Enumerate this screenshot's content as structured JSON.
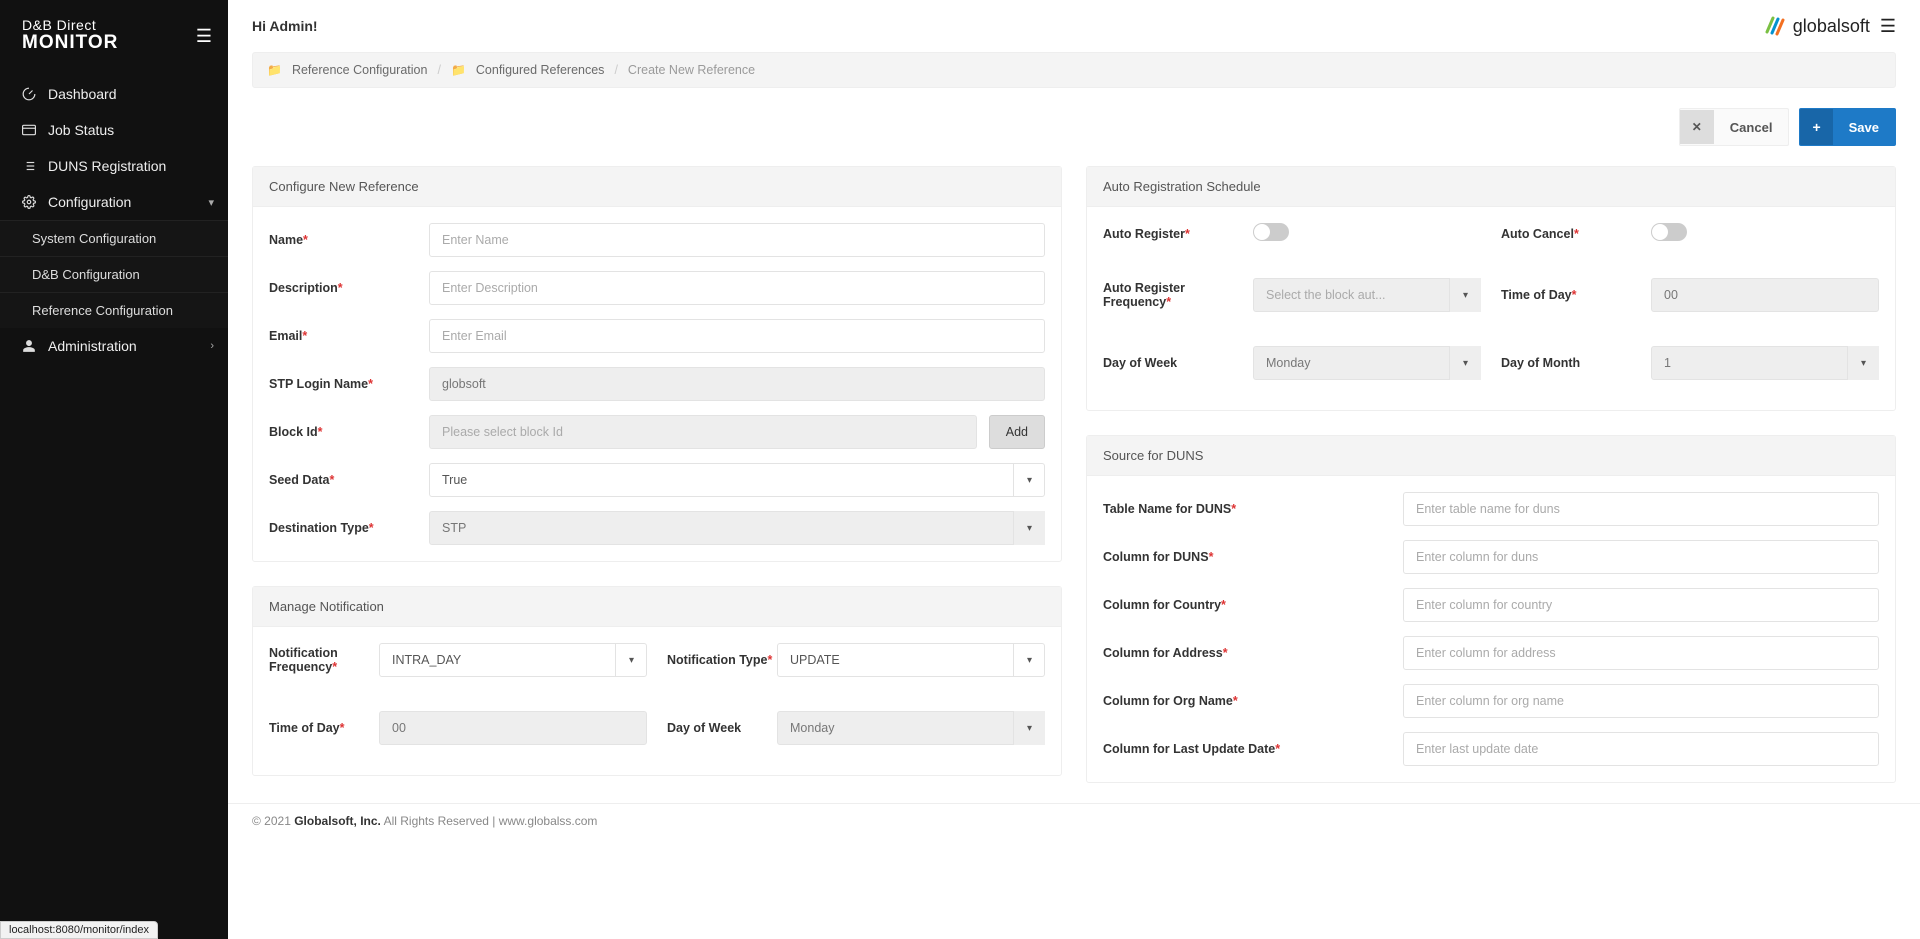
{
  "logo": {
    "line1": "D&B Direct",
    "line2": "MONITOR"
  },
  "sidebar": {
    "items": [
      {
        "icon": "gauge",
        "label": "Dashboard"
      },
      {
        "icon": "card",
        "label": "Job Status"
      },
      {
        "icon": "list",
        "label": "DUNS Registration"
      },
      {
        "icon": "gear",
        "label": "Configuration",
        "expanded": true,
        "children": [
          {
            "label": "System Configuration"
          },
          {
            "label": "D&B Configuration"
          },
          {
            "label": "Reference Configuration"
          }
        ]
      },
      {
        "icon": "user",
        "label": "Administration",
        "expanded": false
      }
    ]
  },
  "header": {
    "greeting": "Hi Admin!",
    "brand": "globalsoft"
  },
  "breadcrumbs": {
    "item1": "Reference Configuration",
    "item2": "Configured References",
    "current": "Create New Reference"
  },
  "actions": {
    "cancel": "Cancel",
    "save": "Save"
  },
  "configure": {
    "title": "Configure New Reference",
    "name_label": "Name",
    "name_ph": "Enter Name",
    "desc_label": "Description",
    "desc_ph": "Enter Description",
    "email_label": "Email",
    "email_ph": "Enter Email",
    "stp_label": "STP Login Name",
    "stp_val": "globsoft",
    "blockid_label": "Block Id",
    "blockid_ph": "Please select block Id",
    "add_btn": "Add",
    "seed_label": "Seed Data",
    "seed_val": "True",
    "dest_label": "Destination Type",
    "dest_val": "STP"
  },
  "notif": {
    "title": "Manage Notification",
    "freq_label": "Notification Frequency",
    "freq_val": "INTRA_DAY",
    "type_label": "Notification Type",
    "type_val": "UPDATE",
    "tod_label": "Time of Day",
    "tod_val": "00",
    "dow_label": "Day of Week",
    "dow_val": "Monday"
  },
  "auto": {
    "title": "Auto Registration Schedule",
    "reg_label": "Auto Register",
    "cancel_label": "Auto Cancel",
    "freq_label": "Auto Register Frequency",
    "freq_ph": "Select the block aut...",
    "tod_label": "Time of Day",
    "tod_val": "00",
    "dow_label": "Day of Week",
    "dow_val": "Monday",
    "dom_label": "Day of Month",
    "dom_val": "1"
  },
  "source": {
    "title": "Source for DUNS",
    "table_label": "Table Name for DUNS",
    "table_ph": "Enter table name for duns",
    "duns_label": "Column for DUNS",
    "duns_ph": "Enter column for duns",
    "country_label": "Column for Country",
    "country_ph": "Enter column for country",
    "addr_label": "Column for Address",
    "addr_ph": "Enter column for address",
    "org_label": "Column for Org Name",
    "org_ph": "Enter column for org name",
    "upd_label": "Column for Last Update Date",
    "upd_ph": "Enter last update date"
  },
  "footer": {
    "copy": "© 2021 ",
    "company": "Globalsoft, Inc.",
    "rest": " All Rights Reserved | www.globalss.com"
  },
  "status_url": "localhost:8080/monitor/index"
}
